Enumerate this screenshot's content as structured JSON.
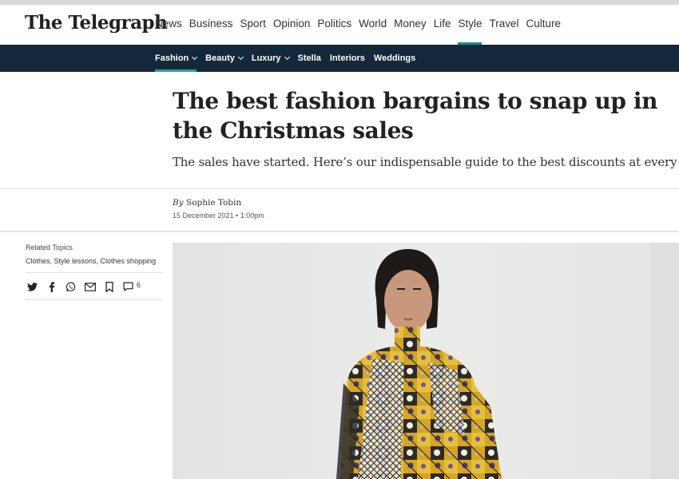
{
  "brand": {
    "logo_text": "The Telegraph"
  },
  "main_nav": [
    {
      "label": "News",
      "active": false
    },
    {
      "label": "Business",
      "active": false
    },
    {
      "label": "Sport",
      "active": false
    },
    {
      "label": "Opinion",
      "active": false
    },
    {
      "label": "Politics",
      "active": false
    },
    {
      "label": "World",
      "active": false
    },
    {
      "label": "Money",
      "active": false
    },
    {
      "label": "Life",
      "active": false
    },
    {
      "label": "Style",
      "active": true
    },
    {
      "label": "Travel",
      "active": false
    },
    {
      "label": "Culture",
      "active": false
    }
  ],
  "sub_nav": [
    {
      "label": "Fashion",
      "dropdown": true,
      "active": true
    },
    {
      "label": "Beauty",
      "dropdown": true,
      "active": false
    },
    {
      "label": "Luxury",
      "dropdown": true,
      "active": false
    },
    {
      "label": "Stella",
      "dropdown": false,
      "active": false
    },
    {
      "label": "Interiors",
      "dropdown": false,
      "active": false
    },
    {
      "label": "Weddings",
      "dropdown": false,
      "active": false
    }
  ],
  "article": {
    "headline": "The best fashion bargains to snap up in the Christmas sales",
    "standfirst": "The sales have started. Here’s our indispensable guide to the best discounts at every store",
    "byline_prefix": "By",
    "author": "Sophie Tobin",
    "date": "15 December 2021 • 1:00pm"
  },
  "sidebar": {
    "related_title": "Related Topics",
    "related_topics": "Clothes, Style lessons, Clothes shopping",
    "share_icons": [
      "twitter-icon",
      "facebook-icon",
      "whatsapp-icon",
      "email-icon",
      "bookmark-icon",
      "comments-icon"
    ],
    "comment_count": "6"
  },
  "colors": {
    "subnav_bg": "#13283a",
    "accent": "#1d8c8d",
    "text": "#222222"
  }
}
